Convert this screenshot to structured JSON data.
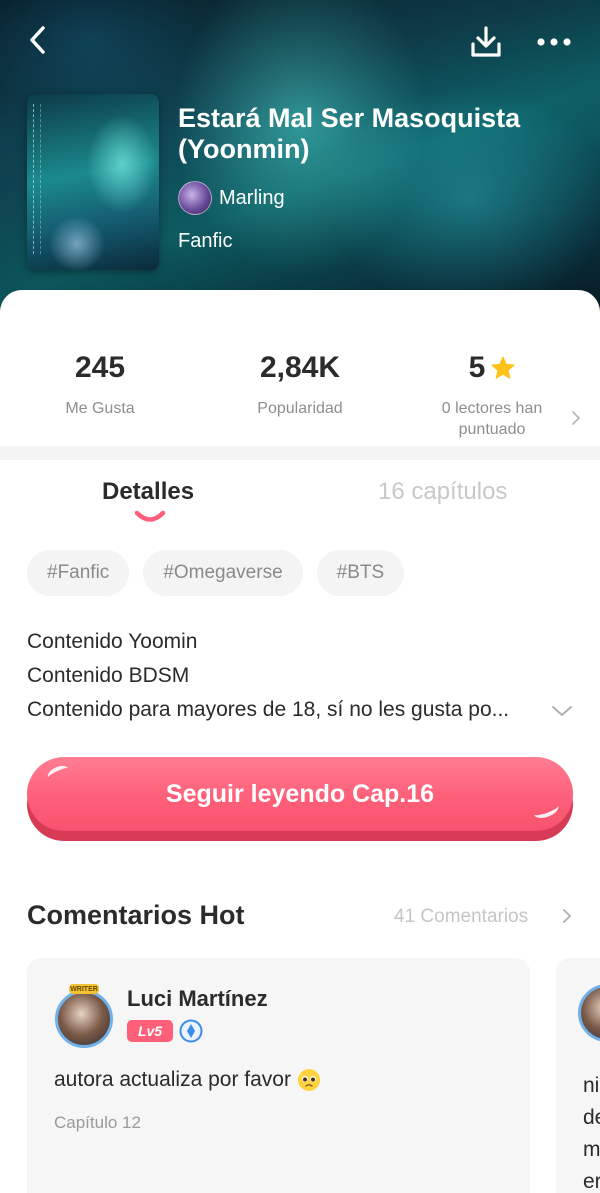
{
  "book": {
    "title": "Estará Mal Ser Masoquista (Yoonmin)",
    "author": "Marling",
    "type": "Fanfic"
  },
  "stats": {
    "likes_value": "245",
    "likes_label": "Me Gusta",
    "popularity_value": "2,84K",
    "popularity_label": "Popularidad",
    "rating_value": "5",
    "rating_label_1": "0 lectores han",
    "rating_label_2": "puntuado"
  },
  "tabs": {
    "details": "Detalles",
    "chapters": "16 capítulos"
  },
  "tags": [
    "#Fanfic",
    "#Omegaverse",
    "#BTS"
  ],
  "description": [
    "Contenido Yoomin",
    "Contenido BDSM",
    "Contenido para mayores de 18, sí no les gusta po..."
  ],
  "cta": {
    "label": "Seguir leyendo Cap.16"
  },
  "comments": {
    "title": "Comentarios Hot",
    "count_label": "41 Comentarios",
    "items": [
      {
        "user": "Luci Martínez",
        "level": "Lv5",
        "badge": "WRITER",
        "text": "autora actualiza por favor",
        "chapter": "Capítulo 12"
      }
    ],
    "next_preview": [
      "ni",
      "de",
      "m",
      "er"
    ]
  },
  "colors": {
    "accent": "#ff5f79",
    "star": "#ffc21a",
    "muted": "#8e8e8e"
  },
  "icons": {
    "back": "chevron-left-icon",
    "download": "download-icon",
    "more": "more-dots-icon",
    "star": "star-icon",
    "emoji": "pleading-face-icon"
  }
}
